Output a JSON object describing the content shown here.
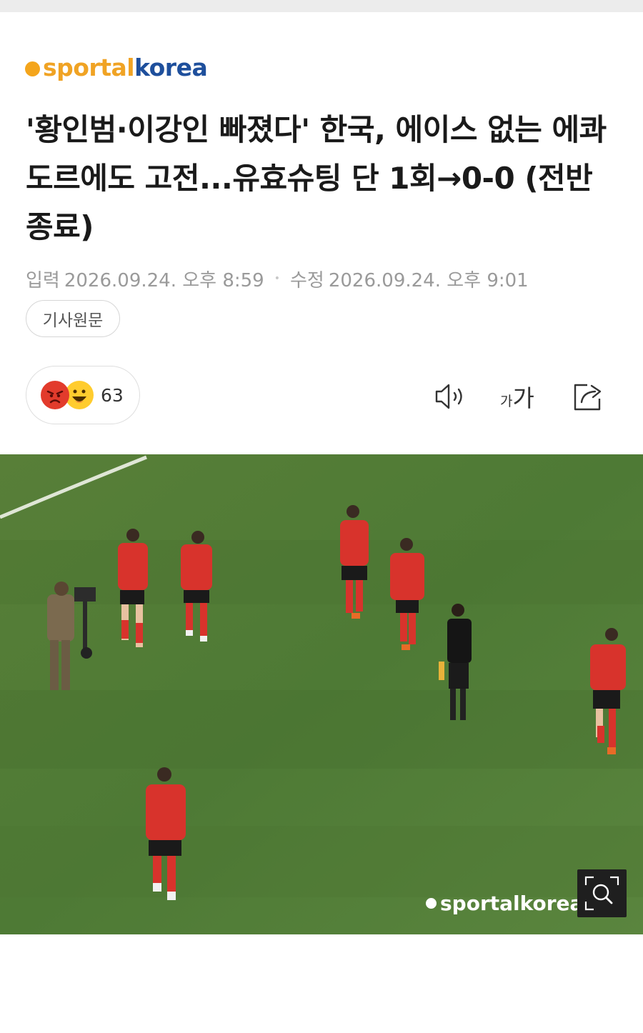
{
  "logo": {
    "sportal": "sportal",
    "korea": "korea"
  },
  "headline": "'황인범·이강인 빠졌다' 한국, 에이스 없는 에콰도르에도 고전...유효슈팅 단 1회→0-0 (전반 종료)",
  "meta": {
    "published_label": "입력",
    "published": "2026.09.24. 오후 8:59",
    "separator": "•",
    "modified_label": "수정",
    "modified": "2026.09.24. 오후 9:01"
  },
  "original_article_button": "기사원문",
  "reactions": {
    "count": "63",
    "icons": [
      "angry-emoji-icon",
      "smile-emoji-icon"
    ]
  },
  "toolbar": {
    "font_small": "가",
    "font_large": "가",
    "icons": [
      "speaker-icon",
      "font-size-icon",
      "share-icon"
    ]
  },
  "photo": {
    "watermark_sportal": "sportal",
    "watermark_korea": "korea"
  },
  "colors": {
    "brand_orange": "#f0a324",
    "brand_blue": "#1e4f9c",
    "meta_gray": "#9a9a9a",
    "pitch_green": "#4f7f3a",
    "jersey_red": "#d8332c"
  }
}
